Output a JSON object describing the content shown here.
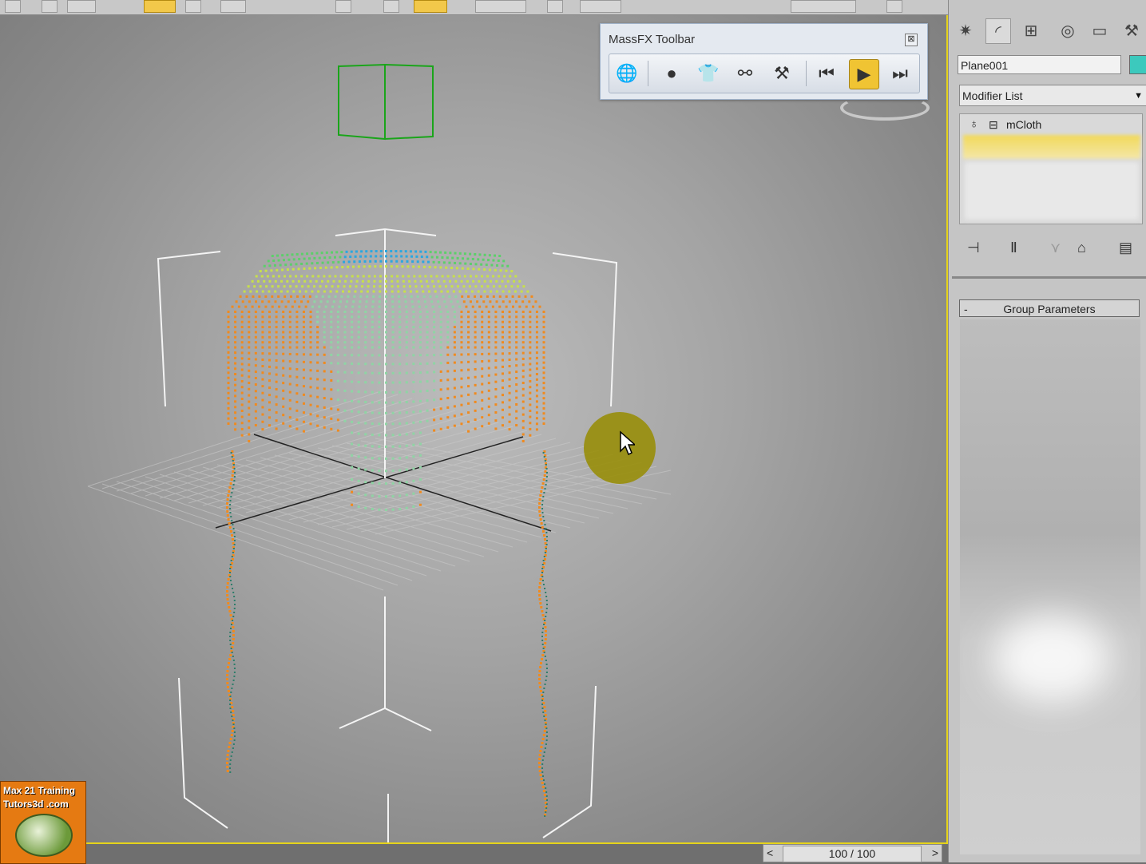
{
  "massfx_toolbar": {
    "title": "MassFX Toolbar",
    "close_glyph": "⊠",
    "buttons": [
      {
        "icon": "world-settings-icon",
        "glyph": "🌐"
      },
      {
        "icon": "rigid-body-icon",
        "glyph": "●"
      },
      {
        "icon": "mcloth-icon",
        "glyph": "👕"
      },
      {
        "icon": "constraint-icon",
        "glyph": "⚯"
      },
      {
        "icon": "ragdoll-icon",
        "glyph": "⚒"
      },
      {
        "icon": "reset-simulation-icon",
        "glyph": "⏮"
      },
      {
        "icon": "play-simulation-icon",
        "glyph": "▶",
        "active": true
      },
      {
        "icon": "step-simulation-icon",
        "glyph": "⏭"
      }
    ]
  },
  "command_panel": {
    "tabs": [
      {
        "icon": "create-icon",
        "glyph": "✷"
      },
      {
        "icon": "modify-icon",
        "glyph": "◜",
        "active": true
      },
      {
        "icon": "hierarchy-icon",
        "glyph": "⊞"
      },
      {
        "icon": "motion-icon",
        "glyph": "◎"
      },
      {
        "icon": "display-icon",
        "glyph": "▭"
      },
      {
        "icon": "utilities-icon",
        "glyph": "⚒"
      }
    ],
    "object_name": "Plane001",
    "object_color": "#3cc9bd",
    "modifier_list_label": "Modifier List",
    "stack_item": "mCloth",
    "rollout_toggle": "-",
    "rollout_title": "Group Parameters"
  },
  "timeline": {
    "prev": "<",
    "next": ">",
    "frame": "100 / 100"
  },
  "watermark": {
    "line1": "Max 21 Training",
    "line2": "Tutors3d .com"
  },
  "colors": {
    "viewport_border": "#e5d31a",
    "active_button": "#f0c433",
    "cloth_top": "#2aa7e0",
    "cloth_mid": "#8fd4a4",
    "cloth_edge": "#f08a1e"
  }
}
